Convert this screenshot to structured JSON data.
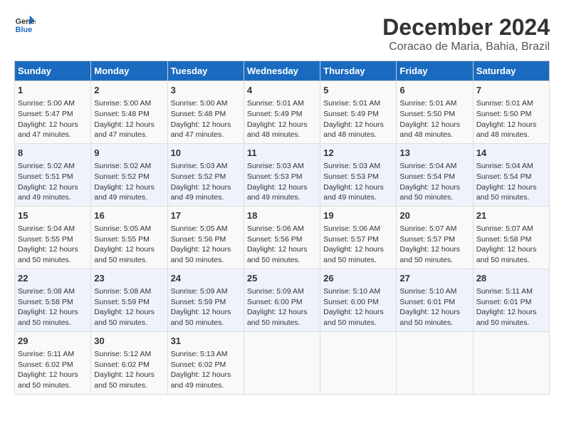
{
  "logo": {
    "line1": "General",
    "line2": "Blue"
  },
  "title": "December 2024",
  "subtitle": "Coracao de Maria, Bahia, Brazil",
  "days_of_week": [
    "Sunday",
    "Monday",
    "Tuesday",
    "Wednesday",
    "Thursday",
    "Friday",
    "Saturday"
  ],
  "weeks": [
    [
      {
        "day": 1,
        "info": "Sunrise: 5:00 AM\nSunset: 5:47 PM\nDaylight: 12 hours\nand 47 minutes."
      },
      {
        "day": 2,
        "info": "Sunrise: 5:00 AM\nSunset: 5:48 PM\nDaylight: 12 hours\nand 47 minutes."
      },
      {
        "day": 3,
        "info": "Sunrise: 5:00 AM\nSunset: 5:48 PM\nDaylight: 12 hours\nand 47 minutes."
      },
      {
        "day": 4,
        "info": "Sunrise: 5:01 AM\nSunset: 5:49 PM\nDaylight: 12 hours\nand 48 minutes."
      },
      {
        "day": 5,
        "info": "Sunrise: 5:01 AM\nSunset: 5:49 PM\nDaylight: 12 hours\nand 48 minutes."
      },
      {
        "day": 6,
        "info": "Sunrise: 5:01 AM\nSunset: 5:50 PM\nDaylight: 12 hours\nand 48 minutes."
      },
      {
        "day": 7,
        "info": "Sunrise: 5:01 AM\nSunset: 5:50 PM\nDaylight: 12 hours\nand 48 minutes."
      }
    ],
    [
      {
        "day": 8,
        "info": "Sunrise: 5:02 AM\nSunset: 5:51 PM\nDaylight: 12 hours\nand 49 minutes."
      },
      {
        "day": 9,
        "info": "Sunrise: 5:02 AM\nSunset: 5:52 PM\nDaylight: 12 hours\nand 49 minutes."
      },
      {
        "day": 10,
        "info": "Sunrise: 5:03 AM\nSunset: 5:52 PM\nDaylight: 12 hours\nand 49 minutes."
      },
      {
        "day": 11,
        "info": "Sunrise: 5:03 AM\nSunset: 5:53 PM\nDaylight: 12 hours\nand 49 minutes."
      },
      {
        "day": 12,
        "info": "Sunrise: 5:03 AM\nSunset: 5:53 PM\nDaylight: 12 hours\nand 49 minutes."
      },
      {
        "day": 13,
        "info": "Sunrise: 5:04 AM\nSunset: 5:54 PM\nDaylight: 12 hours\nand 50 minutes."
      },
      {
        "day": 14,
        "info": "Sunrise: 5:04 AM\nSunset: 5:54 PM\nDaylight: 12 hours\nand 50 minutes."
      }
    ],
    [
      {
        "day": 15,
        "info": "Sunrise: 5:04 AM\nSunset: 5:55 PM\nDaylight: 12 hours\nand 50 minutes."
      },
      {
        "day": 16,
        "info": "Sunrise: 5:05 AM\nSunset: 5:55 PM\nDaylight: 12 hours\nand 50 minutes."
      },
      {
        "day": 17,
        "info": "Sunrise: 5:05 AM\nSunset: 5:56 PM\nDaylight: 12 hours\nand 50 minutes."
      },
      {
        "day": 18,
        "info": "Sunrise: 5:06 AM\nSunset: 5:56 PM\nDaylight: 12 hours\nand 50 minutes."
      },
      {
        "day": 19,
        "info": "Sunrise: 5:06 AM\nSunset: 5:57 PM\nDaylight: 12 hours\nand 50 minutes."
      },
      {
        "day": 20,
        "info": "Sunrise: 5:07 AM\nSunset: 5:57 PM\nDaylight: 12 hours\nand 50 minutes."
      },
      {
        "day": 21,
        "info": "Sunrise: 5:07 AM\nSunset: 5:58 PM\nDaylight: 12 hours\nand 50 minutes."
      }
    ],
    [
      {
        "day": 22,
        "info": "Sunrise: 5:08 AM\nSunset: 5:58 PM\nDaylight: 12 hours\nand 50 minutes."
      },
      {
        "day": 23,
        "info": "Sunrise: 5:08 AM\nSunset: 5:59 PM\nDaylight: 12 hours\nand 50 minutes."
      },
      {
        "day": 24,
        "info": "Sunrise: 5:09 AM\nSunset: 5:59 PM\nDaylight: 12 hours\nand 50 minutes."
      },
      {
        "day": 25,
        "info": "Sunrise: 5:09 AM\nSunset: 6:00 PM\nDaylight: 12 hours\nand 50 minutes."
      },
      {
        "day": 26,
        "info": "Sunrise: 5:10 AM\nSunset: 6:00 PM\nDaylight: 12 hours\nand 50 minutes."
      },
      {
        "day": 27,
        "info": "Sunrise: 5:10 AM\nSunset: 6:01 PM\nDaylight: 12 hours\nand 50 minutes."
      },
      {
        "day": 28,
        "info": "Sunrise: 5:11 AM\nSunset: 6:01 PM\nDaylight: 12 hours\nand 50 minutes."
      }
    ],
    [
      {
        "day": 29,
        "info": "Sunrise: 5:11 AM\nSunset: 6:02 PM\nDaylight: 12 hours\nand 50 minutes."
      },
      {
        "day": 30,
        "info": "Sunrise: 5:12 AM\nSunset: 6:02 PM\nDaylight: 12 hours\nand 50 minutes."
      },
      {
        "day": 31,
        "info": "Sunrise: 5:13 AM\nSunset: 6:02 PM\nDaylight: 12 hours\nand 49 minutes."
      },
      null,
      null,
      null,
      null
    ]
  ]
}
